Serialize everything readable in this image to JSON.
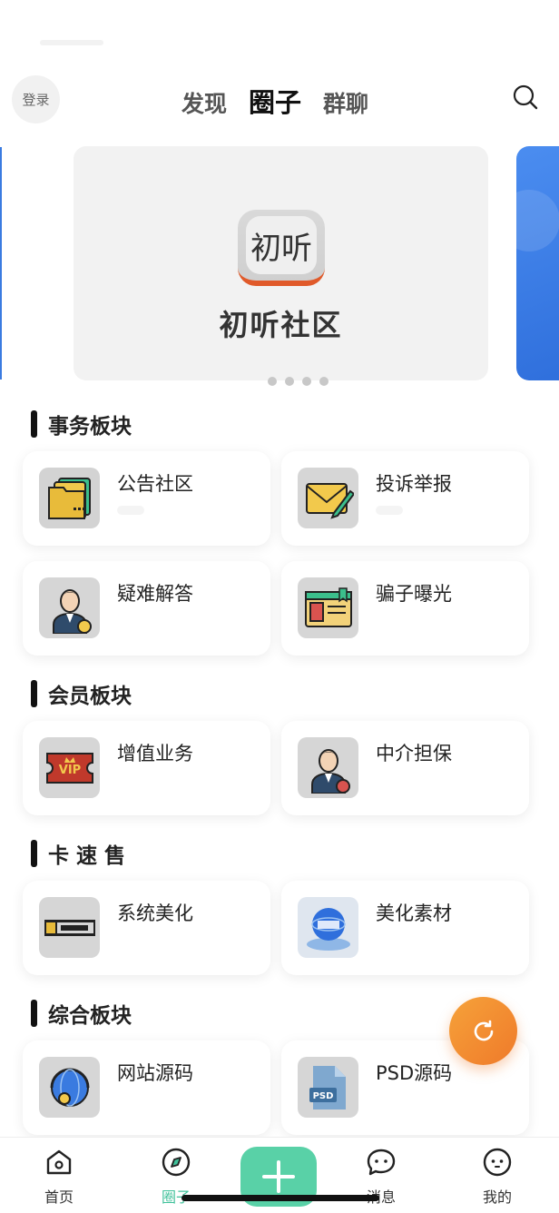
{
  "header": {
    "login_label": "登录",
    "tabs": [
      {
        "label": "发现",
        "active": false
      },
      {
        "label": "圈子",
        "active": true
      },
      {
        "label": "群聊",
        "active": false
      }
    ]
  },
  "banner": {
    "logo_text": "初听",
    "title": "初听社区",
    "right_color": "#3a7be0",
    "dots": 4
  },
  "sections": [
    {
      "title": "事务板块",
      "items": [
        {
          "label": "公告社区",
          "icon": "folder-icon"
        },
        {
          "label": "投诉举报",
          "icon": "envelope-pencil-icon"
        },
        {
          "label": "疑难解答",
          "icon": "person-badge-icon"
        },
        {
          "label": "骗子曝光",
          "icon": "id-card-icon"
        }
      ]
    },
    {
      "title": "会员板块",
      "items": [
        {
          "label": "增值业务",
          "icon": "vip-ticket-icon"
        },
        {
          "label": "中介担保",
          "icon": "person-badge-icon"
        }
      ]
    },
    {
      "title": "卡 速 售",
      "items": [
        {
          "label": "系统美化",
          "icon": "kasushou-logo-icon"
        },
        {
          "label": "美化素材",
          "icon": "globe-icon"
        }
      ]
    },
    {
      "title": "综合板块",
      "items": [
        {
          "label": "网站源码",
          "icon": "headset-globe-icon"
        },
        {
          "label": "PSD源码",
          "icon": "psd-file-icon"
        }
      ]
    }
  ],
  "bottom_nav": {
    "items": [
      {
        "label": "首页",
        "icon": "home-icon",
        "active": false
      },
      {
        "label": "圈子",
        "icon": "compass-icon",
        "active": true
      },
      {
        "label": "消息",
        "icon": "chat-icon",
        "active": false
      },
      {
        "label": "我的",
        "icon": "face-icon",
        "active": false
      }
    ]
  },
  "colors": {
    "accent": "#3fc19a",
    "plus_button": "#59d1a7",
    "fab": "#f08a30"
  }
}
